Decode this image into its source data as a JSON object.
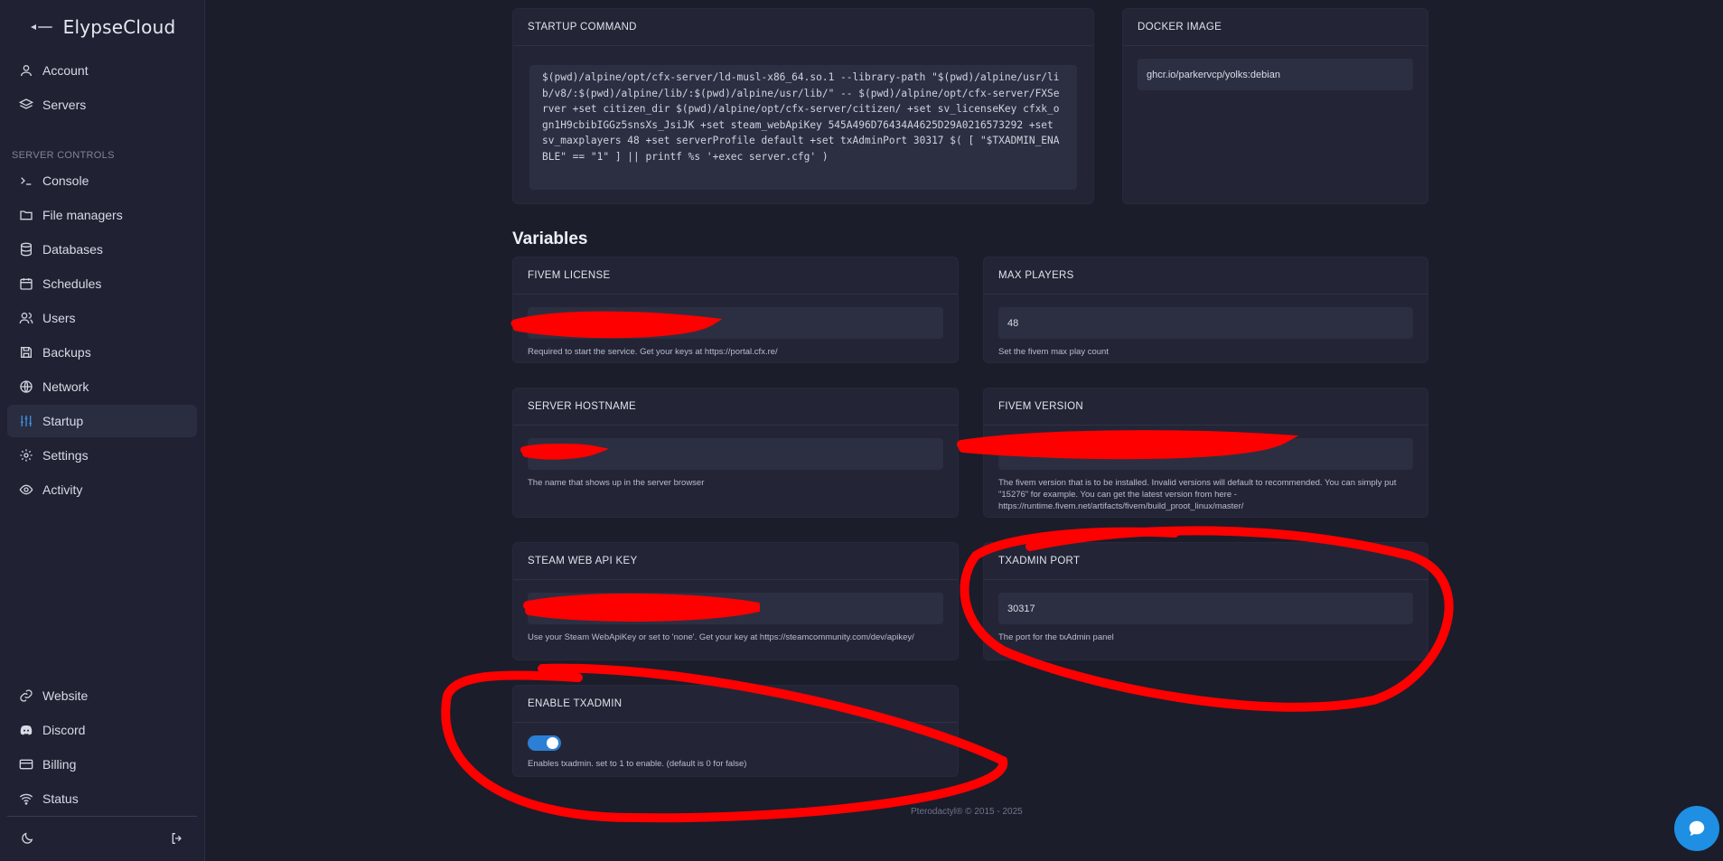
{
  "brand": {
    "name": "ElypseCloud"
  },
  "sidebar": {
    "top_items": [
      {
        "label": "Account"
      },
      {
        "label": "Servers"
      }
    ],
    "section_label": "SERVER CONTROLS",
    "items": [
      {
        "label": "Console"
      },
      {
        "label": "File managers"
      },
      {
        "label": "Databases"
      },
      {
        "label": "Schedules"
      },
      {
        "label": "Users"
      },
      {
        "label": "Backups"
      },
      {
        "label": "Network"
      },
      {
        "label": "Startup"
      },
      {
        "label": "Settings"
      },
      {
        "label": "Activity"
      }
    ],
    "bottom_items": [
      {
        "label": "Website"
      },
      {
        "label": "Discord"
      },
      {
        "label": "Billing"
      },
      {
        "label": "Status"
      }
    ]
  },
  "startup": {
    "title": "STARTUP COMMAND",
    "command": "$(pwd)/alpine/opt/cfx-server/ld-musl-x86_64.so.1 --library-path \"$(pwd)/alpine/usr/lib/v8/:$(pwd)/alpine/lib/:$(pwd)/alpine/usr/lib/\" -- $(pwd)/alpine/opt/cfx-server/FXServer +set citizen_dir $(pwd)/alpine/opt/cfx-server/citizen/ +set sv_licenseKey cfxk_ogn1H9cbibIGGz5snsXs_JsiJK +set steam_webApiKey 545A496D76434A4625D29A0216573292 +set sv_maxplayers 48 +set serverProfile default +set txAdminPort 30317 $( [ \"$TXADMIN_ENABLE\" == \"1\" ] || printf %s '+exec server.cfg' )"
  },
  "docker": {
    "title": "DOCKER IMAGE",
    "value": "ghcr.io/parkervcp/yolks:debian"
  },
  "variables_title": "Variables",
  "variables": {
    "fivem_license": {
      "title": "FIVEM LICENSE",
      "value": "",
      "help": "Required to start the service. Get your keys at https://portal.cfx.re/"
    },
    "max_players": {
      "title": "MAX PLAYERS",
      "value": "48",
      "help": "Set the fivem max play count"
    },
    "server_hostname": {
      "title": "SERVER HOSTNAME",
      "value": "",
      "help": "The name that shows up in the server browser"
    },
    "fivem_version": {
      "title": "FIVEM VERSION",
      "value": "",
      "help": "The fivem version that is to be installed. Invalid versions will default to recommended.  You can simply put \"15276\" for example.  You can get the latest version from here - https://runtime.fivem.net/artifacts/fivem/build_proot_linux/master/"
    },
    "steam_key": {
      "title": "STEAM WEB API KEY",
      "value": "",
      "help": "Use your Steam WebApiKey or set to 'none'. Get your key at https://steamcommunity.com/dev/apikey/"
    },
    "txadmin_port": {
      "title": "TXADMIN PORT",
      "value": "30317",
      "help": "The port for the txAdmin panel"
    },
    "enable_txadmin": {
      "title": "ENABLE TXADMIN",
      "enabled": true,
      "help": "Enables txadmin.  set to 1 to enable. (default is 0 for false)"
    }
  },
  "footer": {
    "text": "Pterodactyl® © 2015 - 2025"
  },
  "colors": {
    "accent": "#2b7fd5",
    "annotation": "#ff0000",
    "chat": "#1e8fe3"
  }
}
